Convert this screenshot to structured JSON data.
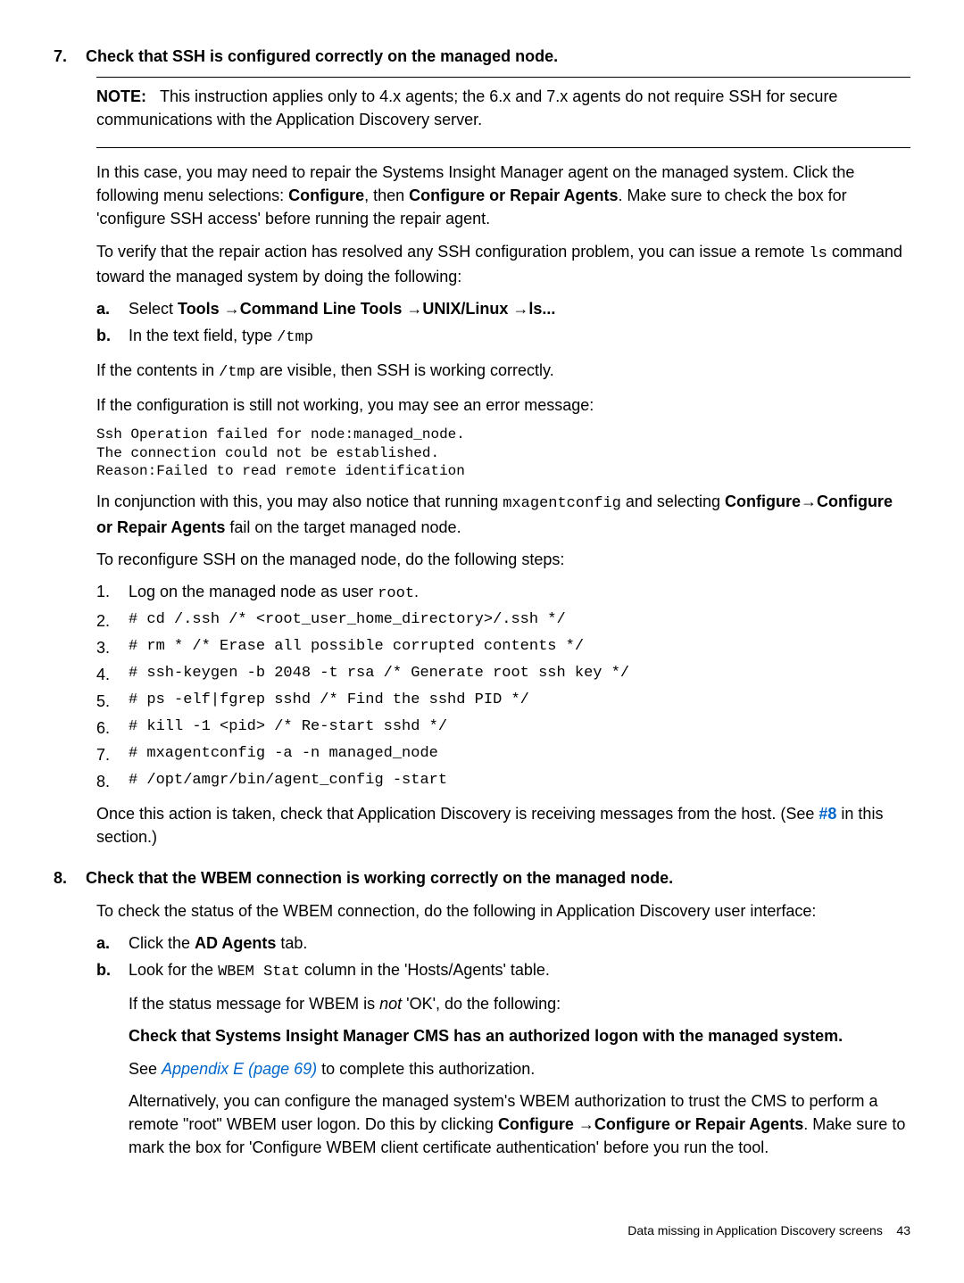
{
  "s7": {
    "num": "7.",
    "title": "Check that SSH is configured correctly on the managed node.",
    "note_label": "NOTE:",
    "note_text": "This instruction applies only to 4.x agents; the 6.x and 7.x agents do not require SSH for secure communications with the Application Discovery server.",
    "p1a": "In this case, you may need to repair the Systems Insight Manager agent on the managed system. Click the following menu selections: ",
    "p1b": "Configure",
    "p1c": ", then ",
    "p1d": "Configure or Repair Agents",
    "p1e": ". Make sure to check the box for 'configure SSH access' before running the repair agent.",
    "p2a": "To verify that the repair action has resolved any SSH configuration problem, you can issue a remote ",
    "p2b": "ls",
    "p2c": " command toward the managed system by doing the following:",
    "a_num": "a.",
    "a_text1": "Select ",
    "a_text2": "Tools →Command Line Tools →UNIX/Linux →ls...",
    "b_num": "b.",
    "b_text1": "In the text field, type ",
    "b_text2": "/tmp",
    "p3a": "If the contents in ",
    "p3b": "/tmp",
    "p3c": " are visible, then SSH is working correctly.",
    "p4": "If the configuration is still not working, you may see an error message:",
    "code1": "Ssh Operation failed for node:managed_node.\nThe connection could not be established.\nReason:Failed to read remote identification",
    "p5a": "In conjunction with this, you may also notice that running ",
    "p5b": "mxagentconfig",
    "p5c": " and selecting ",
    "p5d": "Configure→Configure or Repair Agents",
    "p5e": " fail on the target managed node.",
    "p6": "To reconfigure SSH on the managed node, do the following steps:",
    "steps": [
      {
        "n": "1.",
        "t1": "Log on the managed node as user ",
        "t2": "root",
        "t3": "."
      },
      {
        "n": "2.",
        "t1": "# ",
        "t2": "cd /.ssh /* <root_user_home_directory>/.ssh */"
      },
      {
        "n": "3.",
        "t1": "# ",
        "t2": "rm * /* Erase all possible corrupted contents */"
      },
      {
        "n": "4.",
        "t1": "# ",
        "t2": "ssh-keygen -b 2048 -t rsa /* Generate root ssh key */"
      },
      {
        "n": "5.",
        "t1": "# ",
        "t2": "ps -elf|fgrep sshd /* Find the sshd PID */"
      },
      {
        "n": "6.",
        "t1": "# ",
        "t2": "kill -1 <pid> /* Re-start sshd */"
      },
      {
        "n": "7.",
        "t1": "# ",
        "t2": "mxagentconfig -a -n managed_node"
      },
      {
        "n": "8.",
        "t1": "# ",
        "t2": "/opt/amgr/bin/agent_config -start"
      }
    ],
    "p7a": "Once this action is taken, check that Application Discovery is receiving messages from the host. (See ",
    "p7b": "#8",
    "p7c": " in this section.)"
  },
  "s8": {
    "num": "8.",
    "title": "Check that the WBEM connection is working correctly on the managed node.",
    "p1": "To check the status of the WBEM connection, do the following in Application Discovery user interface:",
    "a_num": "a.",
    "a_text1": "Click the ",
    "a_text2": "AD Agents",
    "a_text3": " tab.",
    "b_num": "b.",
    "b_text1": "Look for the ",
    "b_text2": "WBEM Stat",
    "b_text3": " column in the 'Hosts/Agents' table.",
    "b_p2a": "If the status message for WBEM is ",
    "b_p2b": "not",
    "b_p2c": " 'OK', do the following:",
    "b_bold": "Check that Systems Insight Manager CMS has an authorized logon with the managed system.",
    "b_p3a": "See ",
    "b_p3b": "Appendix E (page 69)",
    "b_p3c": " to complete this authorization.",
    "b_p4a": "Alternatively, you can configure the managed system's WBEM authorization to trust the CMS to perform a remote \"root\" WBEM user logon. Do this by clicking ",
    "b_p4b": "Configure →Configure or Repair Agents",
    "b_p4c": ". Make sure to mark the box for 'Configure WBEM client certificate authentication' before you run the tool."
  },
  "footer": {
    "text": "Data missing in Application Discovery screens",
    "page": "43"
  }
}
